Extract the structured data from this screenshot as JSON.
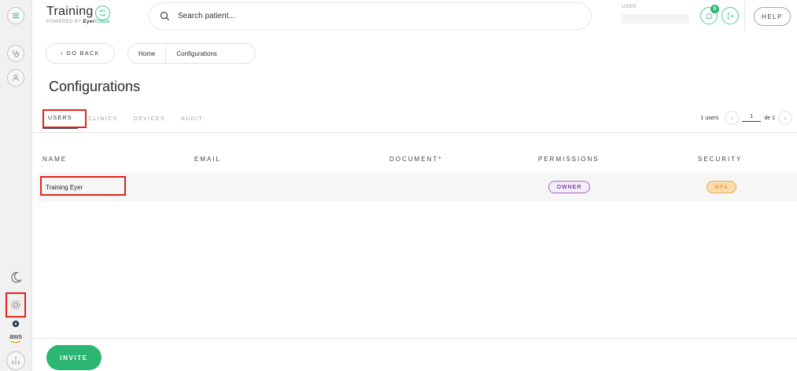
{
  "brand": {
    "title": "Training",
    "powered_by": "POWERED BY",
    "cloud_a": "Eyer",
    "cloud_b": "Cloud"
  },
  "search": {
    "placeholder": "Search patient..."
  },
  "user": {
    "label": "USER"
  },
  "notifications": {
    "count": "0"
  },
  "header": {
    "help_label": "HELP"
  },
  "nav": {
    "go_back": "‹ GO BACK",
    "breadcrumbs": [
      "Home",
      "Configurations"
    ]
  },
  "page": {
    "title": "Configurations"
  },
  "tabs": [
    "USERS",
    "CLINICS",
    "DEVICES",
    "AUDIT"
  ],
  "pagination": {
    "count_label": "1 users",
    "page": "1",
    "of_label": "de 1"
  },
  "table": {
    "columns": [
      "NAME",
      "EMAIL",
      "DOCUMENT*",
      "PERMISSIONS",
      "SECURITY"
    ],
    "rows": [
      {
        "name": "Training Eyer",
        "email": "",
        "document": "",
        "permission": "OWNER",
        "security": "MFA"
      }
    ]
  },
  "footer": {
    "invite_label": "INVITE"
  },
  "sidebar": {
    "version": [
      "v",
      "3.2.6"
    ],
    "aws": "aws"
  },
  "colors": {
    "accent": "#2bb673",
    "highlight": "#e0241b",
    "owner": "#a26ac2",
    "mfa": "#e8a74a"
  }
}
